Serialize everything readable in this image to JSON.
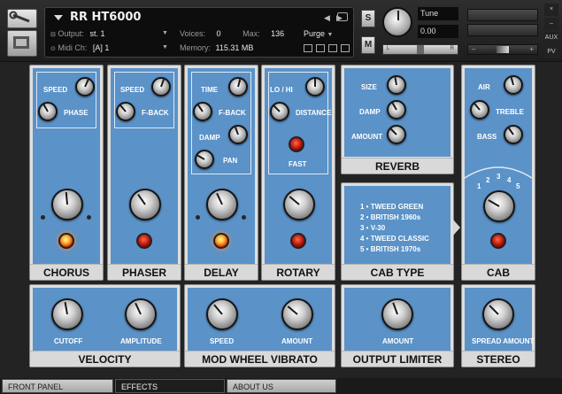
{
  "header": {
    "instrument_name": "RR HT6000",
    "output_label": "Output:",
    "output_value": "st. 1",
    "midi_label": "Midi Ch:",
    "midi_value": "[A]  1",
    "voices_label": "Voices:",
    "voices_value": "0",
    "max_label": "Max:",
    "max_value": "136",
    "purge_label": "Purge",
    "memory_label": "Memory:",
    "memory_value": "115.31 MB",
    "solo_label": "S",
    "mute_label": "M",
    "tune_label": "Tune",
    "tune_value": "0.00",
    "pan_left": "L",
    "pan_right": "R",
    "aux_label": "AUX",
    "pv_label": "PV",
    "close_label": "×",
    "minimize_label": "–"
  },
  "effects": {
    "chorus": {
      "title": "CHORUS",
      "speed": "SPEED",
      "phase": "PHASE"
    },
    "phaser": {
      "title": "PHASER",
      "speed": "SPEED",
      "fback": "F-BACK"
    },
    "delay": {
      "title": "DELAY",
      "time": "TIME",
      "fback": "F-BACK",
      "damp": "DAMP",
      "pan": "PAN"
    },
    "rotary": {
      "title": "ROTARY",
      "lohi": "LO / HI",
      "distance": "DISTANCE",
      "fast": "FAST"
    },
    "reverb": {
      "title": "REVERB",
      "size": "SIZE",
      "damp": "DAMP",
      "amount": "AMOUNT"
    },
    "cab_type": {
      "title": "CAB TYPE",
      "options": [
        "1 • TWEED GREEN",
        "2 • BRITISH 1960s",
        "3 • V-30",
        "4 • TWEED CLASSIC",
        "5 • BRITISH 1970s"
      ]
    },
    "cab": {
      "title": "CAB",
      "air": "AIR",
      "treble": "TREBLE",
      "bass": "BASS",
      "positions": [
        "1",
        "2",
        "3",
        "4",
        "5"
      ]
    },
    "velocity": {
      "title": "VELOCITY",
      "cutoff": "CUTOFF",
      "amplitude": "AMPLITUDE"
    },
    "mod_wheel": {
      "title": "MOD WHEEL VIBRATO",
      "speed": "SPEED",
      "amount": "AMOUNT"
    },
    "output_limiter": {
      "title": "OUTPUT LIMITER",
      "amount": "AMOUNT"
    },
    "stereo": {
      "title": "STEREO",
      "spread": "SPREAD AMOUNT"
    }
  },
  "tabs": [
    {
      "label": "FRONT PANEL",
      "active": false
    },
    {
      "label": "EFFECTS",
      "active": true
    },
    {
      "label": "ABOUT US",
      "active": false
    }
  ],
  "colors": {
    "panel_blue": "#5b92c8",
    "panel_frame": "#dedede",
    "led_red": "#b01308",
    "led_lit": "#ffa628"
  }
}
